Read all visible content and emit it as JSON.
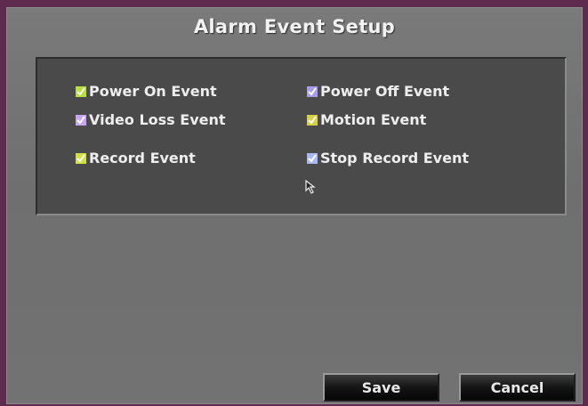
{
  "dialog": {
    "title": "Alarm Event Setup"
  },
  "events": [
    {
      "label": "Power On Event",
      "checked": true,
      "check_color": "#b8e03c"
    },
    {
      "label": "Power Off Event",
      "checked": true,
      "check_color": "#a99cf2"
    },
    {
      "label": "Video Loss Event",
      "checked": true,
      "check_color": "#c8a6ef"
    },
    {
      "label": "Motion Event",
      "checked": true,
      "check_color": "#d7d040"
    },
    {
      "label": "Record Event",
      "checked": true,
      "check_color": "#cfe040"
    },
    {
      "label": "Stop Record Event",
      "checked": true,
      "check_color": "#a8b8f0"
    }
  ],
  "buttons": {
    "save_label": "Save",
    "cancel_label": "Cancel"
  },
  "icons": {
    "cursor": "mouse-pointer-icon",
    "checkbox": "checkbox-checked-icon"
  }
}
